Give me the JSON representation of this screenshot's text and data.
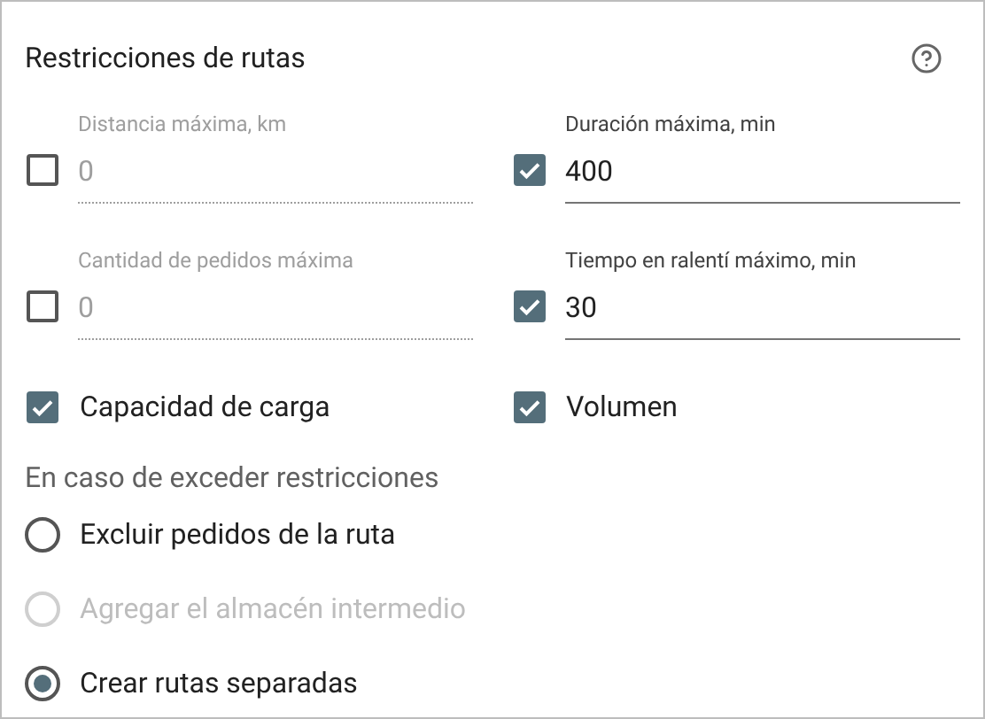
{
  "title": "Restricciones de rutas",
  "limits": [
    {
      "label": "Distancia máxima, km",
      "value": "0",
      "checked": false
    },
    {
      "label": "Duración máxima, min",
      "value": "400",
      "checked": true
    },
    {
      "label": "Cantidad de pedidos máxima",
      "value": "0",
      "checked": false
    },
    {
      "label": "Tiempo en ralentí máximo, min",
      "value": "30",
      "checked": true
    }
  ],
  "load": [
    {
      "label": "Capacidad de carga",
      "checked": true
    },
    {
      "label": "Volumen",
      "checked": true
    }
  ],
  "exceed": {
    "heading": "En caso de exceder restricciones",
    "options": [
      {
        "label": "Excluir pedidos de la ruta",
        "selected": false,
        "disabled": false
      },
      {
        "label": "Agregar el almacén intermedio",
        "selected": false,
        "disabled": true
      },
      {
        "label": "Crear rutas separadas",
        "selected": true,
        "disabled": false
      }
    ]
  }
}
